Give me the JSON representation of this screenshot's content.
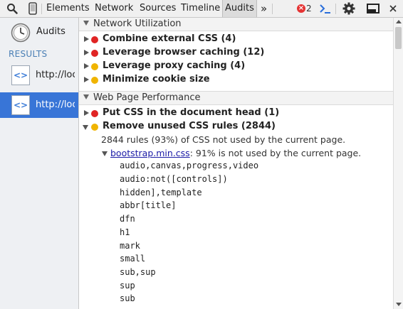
{
  "toolbar": {
    "tabs": [
      {
        "label": "Elements"
      },
      {
        "label": "Network"
      },
      {
        "label": "Sources"
      },
      {
        "label": "Timeline"
      },
      {
        "label": "Audits"
      }
    ],
    "overflow_label": "»",
    "error_count": "2",
    "icons": [
      "search-icon",
      "device-icon",
      "console-icon",
      "settings-icon",
      "dock-icon",
      "close-icon"
    ]
  },
  "sidebar": {
    "audits_label": "Audits",
    "results_header": "RESULTS",
    "items": [
      {
        "label": "http://localhost"
      },
      {
        "label": "http://localhost"
      }
    ]
  },
  "sections": [
    {
      "title": "Network Utilization",
      "rules": [
        {
          "label": "Combine external CSS (4)",
          "severity": "red"
        },
        {
          "label": "Leverage browser caching (12)",
          "severity": "red"
        },
        {
          "label": "Leverage proxy caching (4)",
          "severity": "yellow"
        },
        {
          "label": "Minimize cookie size",
          "severity": "yellow"
        }
      ]
    },
    {
      "title": "Web Page Performance",
      "rules": [
        {
          "label": "Put CSS in the document head (1)",
          "severity": "red"
        },
        {
          "label": "Remove unused CSS rules (2844)",
          "severity": "yellow"
        }
      ]
    }
  ],
  "details": {
    "summary": "2844 rules (93%) of CSS not used by the current page.",
    "file_link": "bootstrap.min.css",
    "file_note": ": 91% is not used by the current page.",
    "selectors": [
      "audio,canvas,progress,video",
      "audio:not([controls])",
      "hidden],template",
      "abbr[title]",
      "dfn",
      "h1",
      "mark",
      "small",
      "sub,sup",
      "sup",
      "sub"
    ]
  },
  "colors": {
    "selected": "#3875d7",
    "error_red": "#e02424",
    "warning_yellow": "#f0b400",
    "link": "#1a1aa6"
  }
}
